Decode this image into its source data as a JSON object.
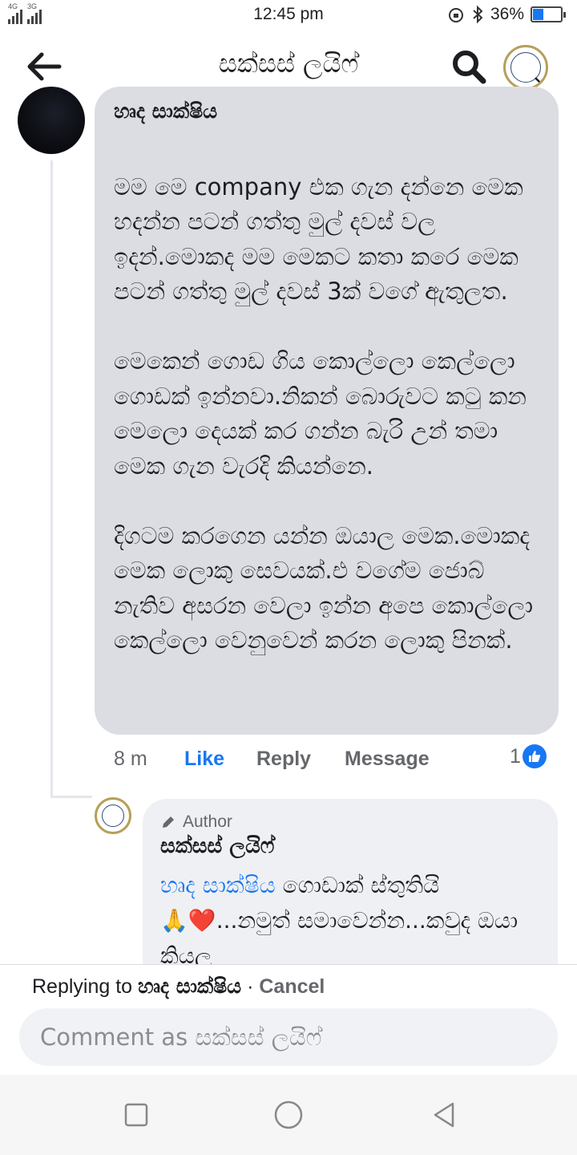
{
  "status_bar": {
    "network_1": "4G",
    "network_2": "3G",
    "time": "12:45 pm",
    "battery": "36%",
    "battery_level": 0.36
  },
  "header": {
    "title": "සක්සස් ලයිෆ්",
    "back_icon": "arrow-left-icon",
    "search_icon": "search-icon"
  },
  "comment": {
    "author": "හෘද සාක්ෂිය",
    "paragraphs": [
      "මම මෙ company  එක ගැන දන්නෙ මෙක හදන්න පටන් ගත්තු මුල් දවස් වල ඉදන්.මොකද මම මෙකට කතා කරෙ මෙක පටන් ගත්තු මුල් දවස් 3ක් වගේ ඇතුලත.",
      "මෙකෙන් ගොඩ ගිය කොල්ලො කෙල්ලො ගොඩක් ඉන්නවා.නිකන් බොරුවට කටු කන මෙලො දෙයක් කර ගන්න බැරි උන් තමා මෙක ගැන වැරදි කියන්නෙ.",
      "දිගටම කරගෙන යන්න ඔයාල මෙක.මොකද මෙක ලොකු සෙවයක්.එ වගේම ජොබ් නැතිව අසරන වෙලා ඉන්න අපෙ කොල්ලො කෙල්ලො වෙනුවෙන් කරන ලොකු පිනක්."
    ],
    "time": "8 m",
    "like_label": "Like",
    "reply_label": "Reply",
    "message_label": "Message",
    "reaction_count": "1"
  },
  "reply": {
    "badge": "Author",
    "author": "සක්සස් ලයිෆ්",
    "mention": "හෘද සාක්ෂිය",
    "text_1": " ගොඩාක් ස්තුතියි",
    "emojis": "🙏❤️",
    "text_2": "...නමුත් සමාවෙන්න...කවුද ඔයා කියල"
  },
  "composer": {
    "replying_prefix": "Replying to ",
    "replying_name": "හෘද සාක්ෂිය",
    "separator": " · ",
    "cancel_label": "Cancel",
    "placeholder": "Comment as සක්සස් ලයිෆ්"
  },
  "colors": {
    "accent": "#1877f2",
    "bubble": "#dcdde3",
    "reply_bubble": "#eff0f3"
  }
}
